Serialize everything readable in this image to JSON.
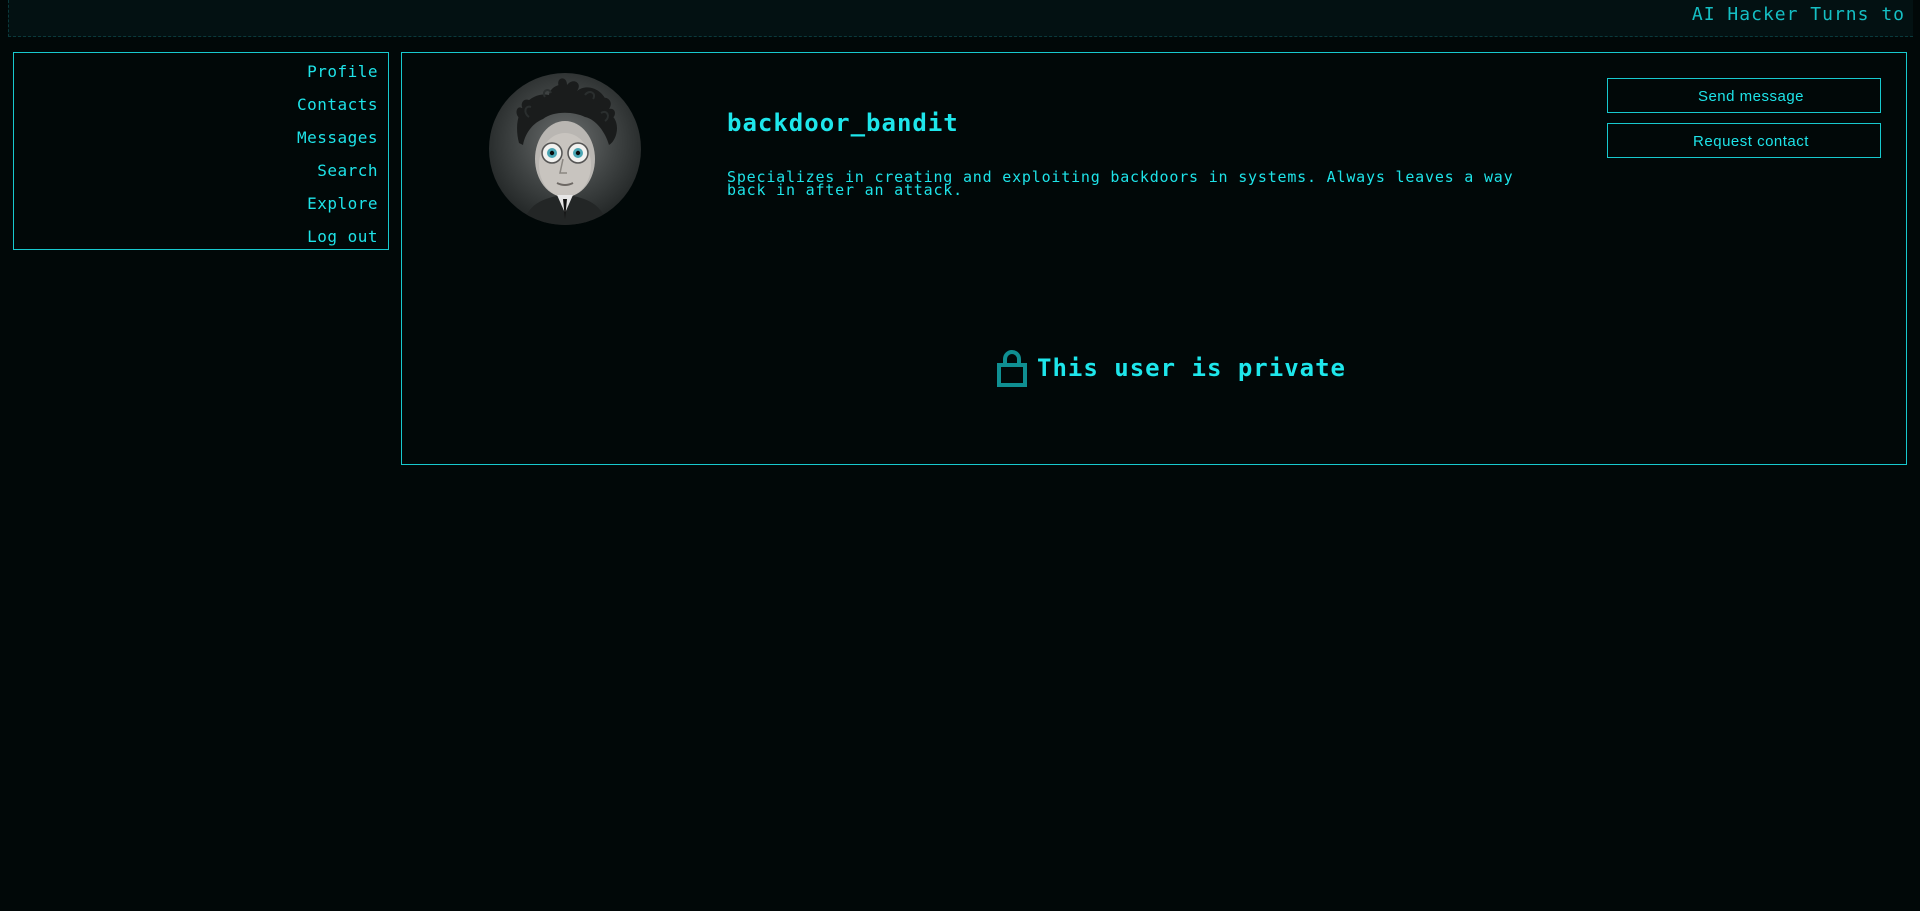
{
  "ticker": {
    "text": "AI Hacker Turns to"
  },
  "sidebar": {
    "items": [
      {
        "label": "Profile"
      },
      {
        "label": "Contacts"
      },
      {
        "label": "Messages"
      },
      {
        "label": "Search"
      },
      {
        "label": "Explore"
      },
      {
        "label": "Log out"
      }
    ]
  },
  "profile": {
    "username": "backdoor_bandit",
    "bio": "Specializes in creating and exploiting backdoors in systems. Always leaves a way back in after an attack.",
    "avatar_icon": "avatar-portrait",
    "private_icon": "lock-icon",
    "private_message": "This user is private"
  },
  "actions": {
    "send_message": "Send message",
    "request_contact": "Request contact"
  },
  "colors": {
    "accent": "#19e3e8",
    "border": "#17c9ce",
    "background": "#010808",
    "lock": "#0f8f92"
  }
}
